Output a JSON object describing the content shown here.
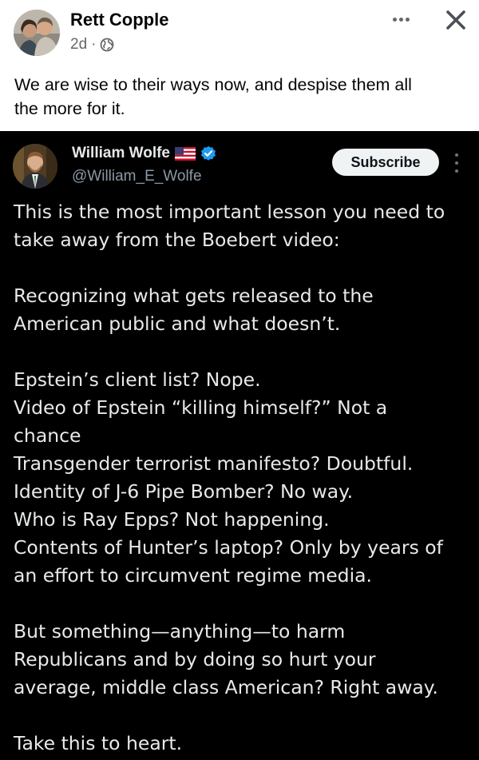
{
  "post": {
    "author": "Rett Copple",
    "time": "2d",
    "separator": "·",
    "privacy_icon": "globe-icon",
    "more_icon": "more-horizontal-icon",
    "close_icon": "close-icon",
    "caption_lines": [
      "We are wise to their ways now, and despise them all",
      "the more for it."
    ]
  },
  "tweet": {
    "name": "William Wolfe",
    "flag_icon": "us-flag-icon",
    "verified_icon": "verified-badge-icon",
    "handle": "@William_E_Wolfe",
    "subscribe_label": "Subscribe",
    "more_icon": "more-vertical-icon",
    "body": {
      "p1": [
        "This is the most important lesson you need to",
        "take away from the Boebert video:"
      ],
      "p2": [
        "Recognizing what gets released to the",
        "American public and what doesn’t."
      ],
      "p3": [
        "Epstein’s client list? Nope.",
        "Video of Epstein “killing himself?” Not a",
        "chance",
        "Transgender terrorist manifesto? Doubtful.",
        "Identity of J-6 Pipe Bomber? No way.",
        "Who is Ray Epps? Not happening.",
        "Contents of Hunter’s laptop? Only by years of",
        "an effort to circumvent regime media."
      ],
      "p4": [
        "But something—anything—to harm",
        "Republicans and by doing so hurt your",
        "average, middle class American? Right away."
      ],
      "p5": [
        "Take this to heart."
      ]
    }
  },
  "colors": {
    "fb_text": "#050505",
    "fb_meta": "#65676b",
    "tweet_bg": "#000000",
    "tweet_text": "#e7e9ea",
    "tweet_handle": "#8b98a5",
    "verified_blue": "#1d9bf0"
  }
}
